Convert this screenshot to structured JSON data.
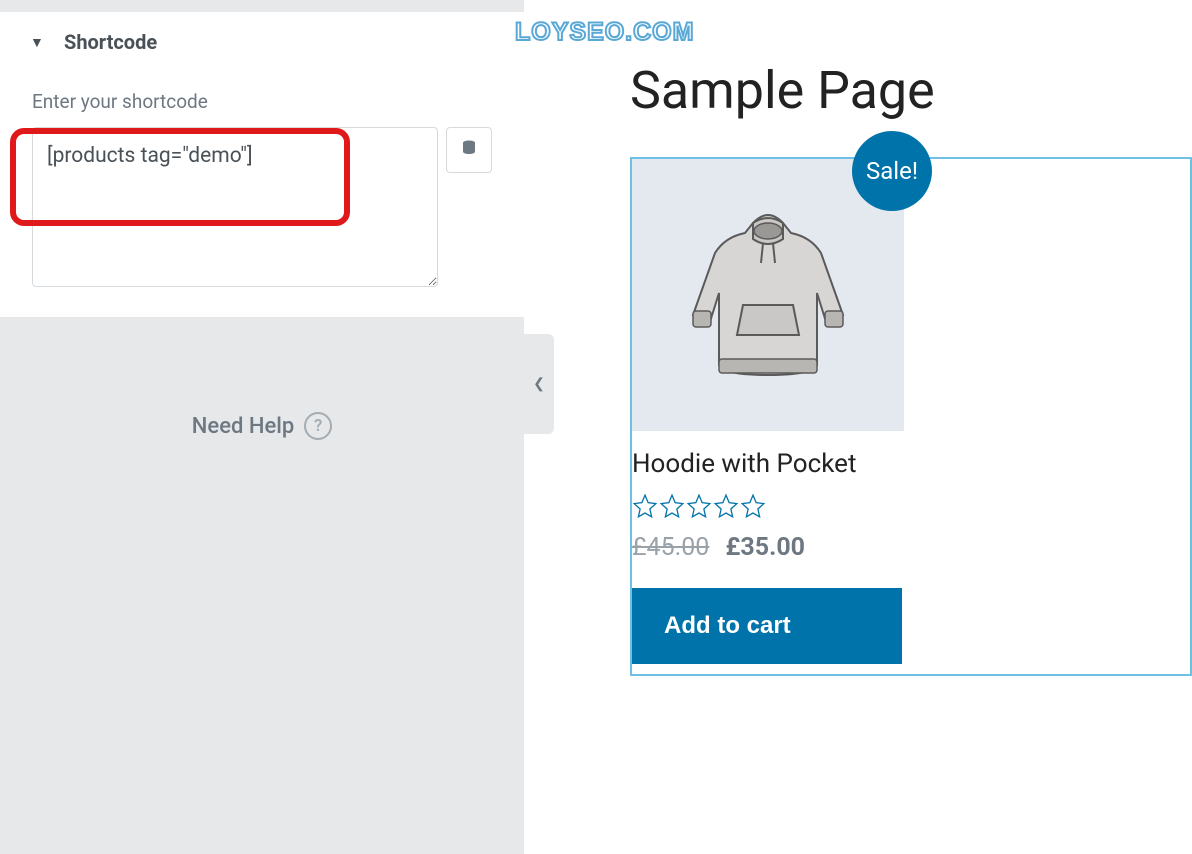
{
  "watermark": "LOYSEO.COM",
  "sidebar": {
    "widget_title": "Shortcode",
    "field_label": "Enter your shortcode",
    "shortcode_value": "[products tag=\"demo\"]",
    "need_help_label": "Need Help",
    "help_glyph": "?"
  },
  "preview": {
    "page_title": "Sample Page",
    "product": {
      "sale_badge": "Sale!",
      "title": "Hoodie with Pocket",
      "old_price": "£45.00",
      "new_price": "£35.00",
      "add_to_cart_label": "Add to cart",
      "rating": 0
    }
  }
}
